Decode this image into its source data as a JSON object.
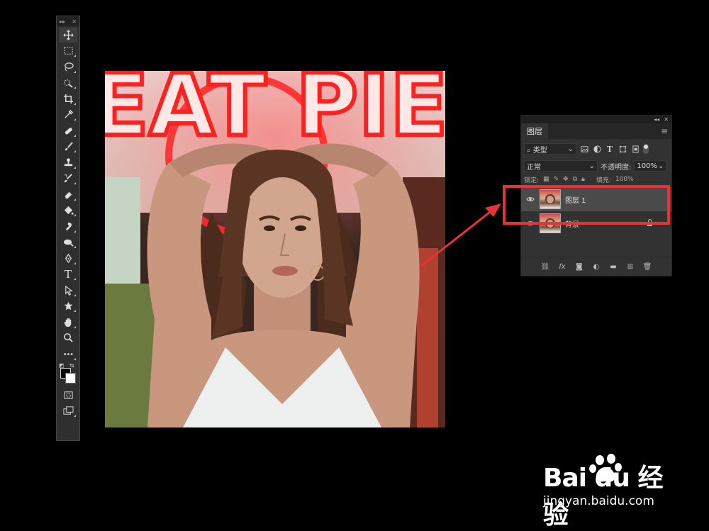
{
  "toolbar": {
    "tools": [
      "move",
      "marquee",
      "lasso",
      "quick-select",
      "crop",
      "eyedropper",
      "healing",
      "brush",
      "stamp",
      "history-brush",
      "eraser",
      "paint-bucket",
      "blur",
      "dodge",
      "pen",
      "type",
      "path-select",
      "shape",
      "hand",
      "zoom",
      "more"
    ],
    "type_glyph": "T"
  },
  "layers_panel": {
    "tab_label": "图层",
    "filter_label": "类型",
    "blend_mode": "正常",
    "opacity_label": "不透明度:",
    "opacity_value": "100%",
    "lock_label": "锁定:",
    "fill_label": "填充:",
    "fill_value": "100%",
    "layers": [
      {
        "name": "图层 1",
        "selected": true,
        "locked": false
      },
      {
        "name": "背景",
        "selected": false,
        "locked": true
      }
    ],
    "footer_fx": "fx"
  },
  "photo": {
    "sign_text": "EAT PIE"
  },
  "watermark": {
    "brand": "Bai du 经验",
    "url": "jingyan.baidu.com"
  },
  "colors": {
    "accent_red": "#e73336",
    "panel_bg": "#323232",
    "app_bg": "#000000"
  }
}
